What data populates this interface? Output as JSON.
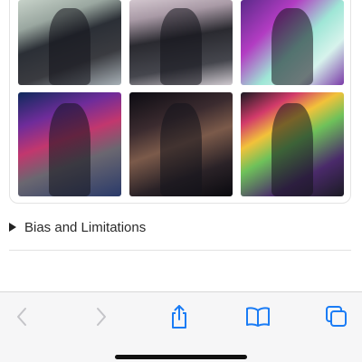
{
  "gallery": {
    "images": [
      {
        "alt": "",
        "tone": "t1"
      },
      {
        "alt": "",
        "tone": "t2"
      },
      {
        "alt": "",
        "tone": "t3"
      },
      {
        "alt": "",
        "tone": "t4"
      },
      {
        "alt": "",
        "tone": "t5"
      },
      {
        "alt": "",
        "tone": "t6"
      }
    ]
  },
  "section": {
    "label": "Bias and Limitations",
    "expanded": false
  },
  "toolbar": {
    "back_icon": "chevron-left-icon",
    "forward_icon": "chevron-right-icon",
    "share_icon": "share-icon",
    "bookmarks_icon": "book-icon",
    "tabs_icon": "tabs-icon",
    "accent": "#1a7cf5",
    "disabled": "#c4c4c8"
  }
}
